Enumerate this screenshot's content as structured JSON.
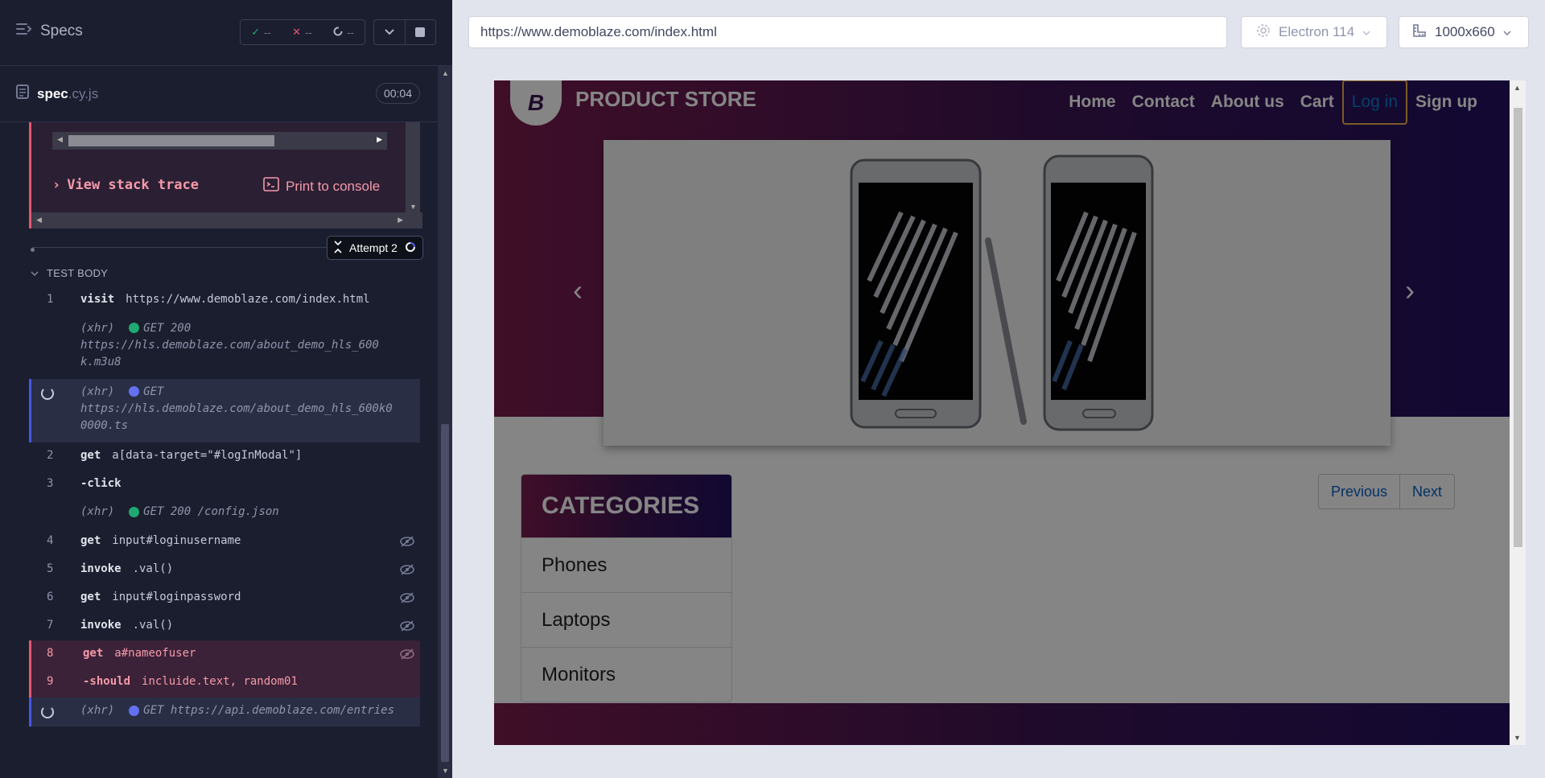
{
  "reporter": {
    "header": {
      "specs_label": "Specs"
    },
    "stats": {
      "passed": "--",
      "failed": "--",
      "pending": "--"
    },
    "spec": {
      "name": "spec",
      "ext": ".cy.js",
      "timer": "00:04"
    },
    "error": {
      "view_stack_trace": "View stack trace",
      "print_to_console": "Print to console"
    },
    "attempt": {
      "label": "Attempt 2"
    },
    "test_body": {
      "label": "TEST BODY"
    },
    "commands": [
      {
        "num": "1",
        "name": "visit",
        "msg": "https://www.demoblaze.com/index.html"
      },
      {
        "xhr": "(xhr)",
        "method": "GET 200",
        "url": "https://hls.demoblaze.com/about_demo_hls_600k.m3u8"
      },
      {
        "xhr": "(xhr)",
        "method": "GET",
        "url": "https://hls.demoblaze.com/about_demo_hls_600k00000.ts"
      },
      {
        "num": "2",
        "name": "get",
        "msg": "a[data-target=\"#logInModal\"]"
      },
      {
        "num": "3",
        "name": "-click",
        "msg": ""
      },
      {
        "xhr": "(xhr)",
        "method": "GET 200 /config.json"
      },
      {
        "num": "4",
        "name": "get",
        "msg": "input#loginusername"
      },
      {
        "num": "5",
        "name": "invoke",
        "msg": ".val()"
      },
      {
        "num": "6",
        "name": "get",
        "msg": "input#loginpassword"
      },
      {
        "num": "7",
        "name": "invoke",
        "msg": ".val()"
      },
      {
        "num": "8",
        "name": "get",
        "msg": "a#nameofuser"
      },
      {
        "num": "9",
        "name": "-should",
        "msg": "incluide.text, random01"
      },
      {
        "xhr": "(xhr)",
        "method": "GET",
        "url": "https://api.demoblaze.com/entries"
      }
    ]
  },
  "aut": {
    "url": "https://www.demoblaze.com/index.html",
    "browser": "Electron 114",
    "viewport": "1000x660"
  },
  "store": {
    "logo_letter": "B",
    "brand": "PRODUCT STORE",
    "nav": [
      "Home",
      "Contact",
      "About us",
      "Cart",
      "Log in",
      "Sign up"
    ],
    "categories_title": "CATEGORIES",
    "categories": [
      "Phones",
      "Laptops",
      "Monitors"
    ],
    "pager": {
      "previous": "Previous",
      "next": "Next"
    },
    "carousel": {
      "prev_glyph": "‹",
      "next_glyph": "›"
    }
  },
  "colors": {
    "accent": "#4956e3",
    "failed": "#e45770",
    "passed": "#1fa971",
    "store_gradient_start": "#7a1b4c",
    "store_gradient_end": "#231160"
  }
}
